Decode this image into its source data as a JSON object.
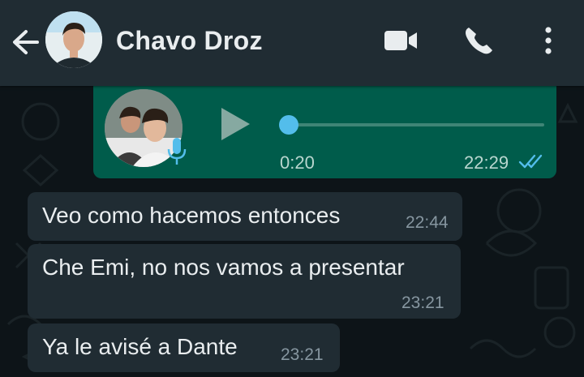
{
  "header": {
    "contact_name": "Chavo Droz",
    "icons": [
      "arrow-back-icon",
      "videocam-icon",
      "phone-icon",
      "more-vert-icon"
    ]
  },
  "messages": [
    {
      "type": "voice",
      "direction": "outgoing",
      "duration": "0:20",
      "time": "22:29",
      "status": "read",
      "progress": 0
    },
    {
      "type": "text",
      "direction": "incoming",
      "text": "Veo como hacemos entonces",
      "time": "22:44"
    },
    {
      "type": "text",
      "direction": "incoming",
      "text": "Che Emi, no nos vamos a presentar",
      "time": "23:21"
    },
    {
      "type": "text",
      "direction": "incoming",
      "text": "Ya le avisé a Dante",
      "time": "23:21"
    }
  ],
  "colors": {
    "header_bg": "#202c33",
    "chat_bg": "#0d1418",
    "outgoing_bubble": "#005c4b",
    "incoming_bubble": "#202c33",
    "read_ticks": "#53bdeb",
    "text": "#e9edef",
    "meta_text": "#8696a0"
  }
}
